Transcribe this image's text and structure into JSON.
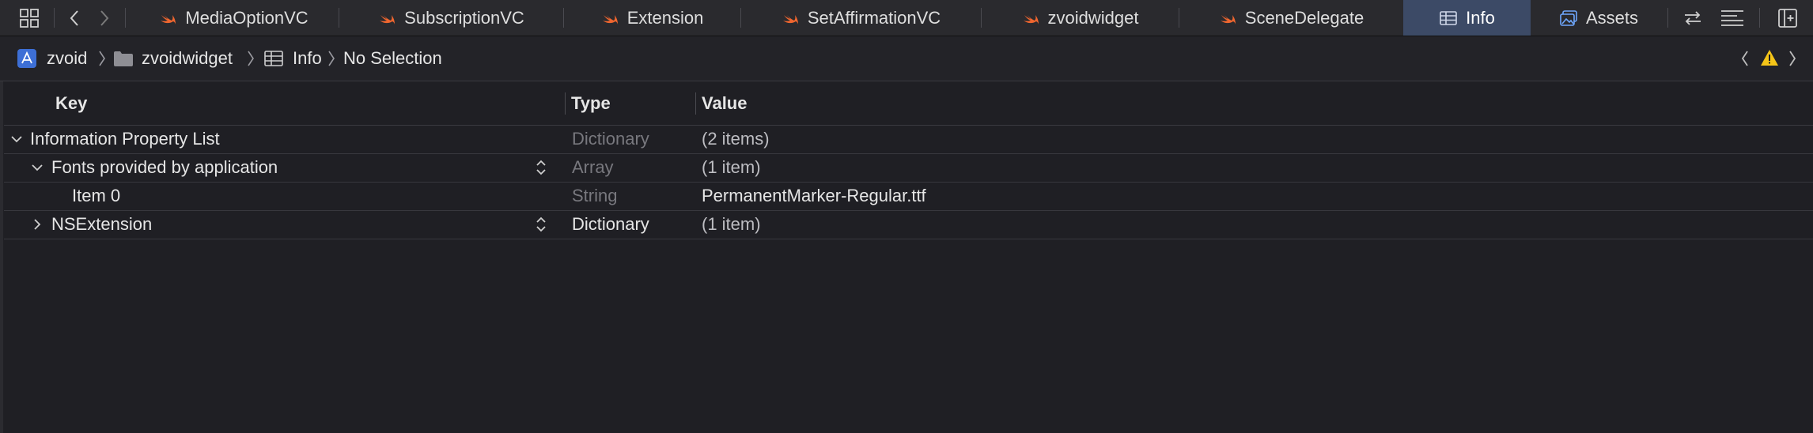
{
  "tabs": [
    {
      "label": "MediaOptionVC",
      "icon": "swift-icon",
      "active": false
    },
    {
      "label": "SubscriptionVC",
      "icon": "swift-icon",
      "active": false
    },
    {
      "label": "Extension",
      "icon": "swift-icon",
      "active": false
    },
    {
      "label": "SetAffirmationVC",
      "icon": "swift-icon",
      "active": false
    },
    {
      "label": "zvoidwidget",
      "icon": "swift-icon",
      "active": false
    },
    {
      "label": "SceneDelegate",
      "icon": "swift-icon",
      "active": false
    },
    {
      "label": "Info",
      "icon": "table-icon",
      "active": true
    },
    {
      "label": "Assets",
      "icon": "assets-icon",
      "active": false
    }
  ],
  "breadcrumb": {
    "project": "zvoid",
    "folder": "zvoidwidget",
    "file": "Info",
    "selection": "No Selection"
  },
  "table": {
    "headers": {
      "key": "Key",
      "type": "Type",
      "value": "Value"
    },
    "rows": [
      {
        "key": "Information Property List",
        "type": "Dictionary",
        "value": "(2 items)"
      },
      {
        "key": "Fonts provided by application",
        "type": "Array",
        "value": "(1 item)"
      },
      {
        "key": "Item 0",
        "type": "String",
        "value": "PermanentMarker-Regular.ttf"
      },
      {
        "key": "NSExtension",
        "type": "Dictionary",
        "value": "(1 item)"
      }
    ]
  },
  "colors": {
    "background": "#1f1f24",
    "tabbar": "#2a2a2e",
    "active_tab": "#3c4a66",
    "swift_orange": "#f0662f",
    "warning": "#f5c518"
  }
}
